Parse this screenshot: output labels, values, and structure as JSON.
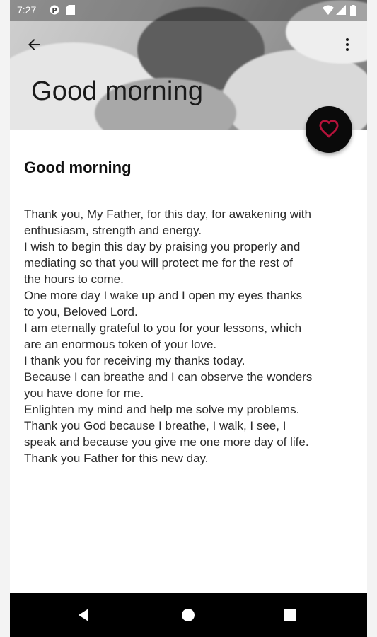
{
  "status_bar": {
    "time": "7:27",
    "icons": [
      "notification-icon",
      "sd-card-icon",
      "wifi-icon",
      "signal-icon",
      "battery-icon"
    ]
  },
  "toolbar": {
    "back_icon": "arrow-left-icon",
    "overflow_icon": "more-vert-icon"
  },
  "header": {
    "title": "Good morning"
  },
  "fab": {
    "icon": "heart-outline-icon",
    "accent_color": "#b5123a"
  },
  "content": {
    "title": "Good morning",
    "lines": [
      "Thank you, My Father, for this day, for awakening with",
      "enthusiasm, strength and energy.",
      "I wish to begin this day by praising you properly and",
      "mediating so that you will protect me for the rest of",
      "the hours to come.",
      "One more day I wake up and I open my eyes thanks",
      "to you, Beloved Lord.",
      "I am eternally grateful to you for your lessons, which",
      "are an enormous token of your love.",
      "I thank you for receiving my thanks today.",
      "Because I can breathe and I can observe the wonders",
      "you have done for me.",
      "Enlighten my mind and help me solve my problems.",
      "Thank you God because I breathe, I walk, I see, I",
      "speak and because you give me one more day of life.",
      "Thank you Father for this new day."
    ]
  },
  "nav_bar": {
    "buttons": [
      "back-triangle-icon",
      "home-circle-icon",
      "recents-square-icon"
    ]
  }
}
